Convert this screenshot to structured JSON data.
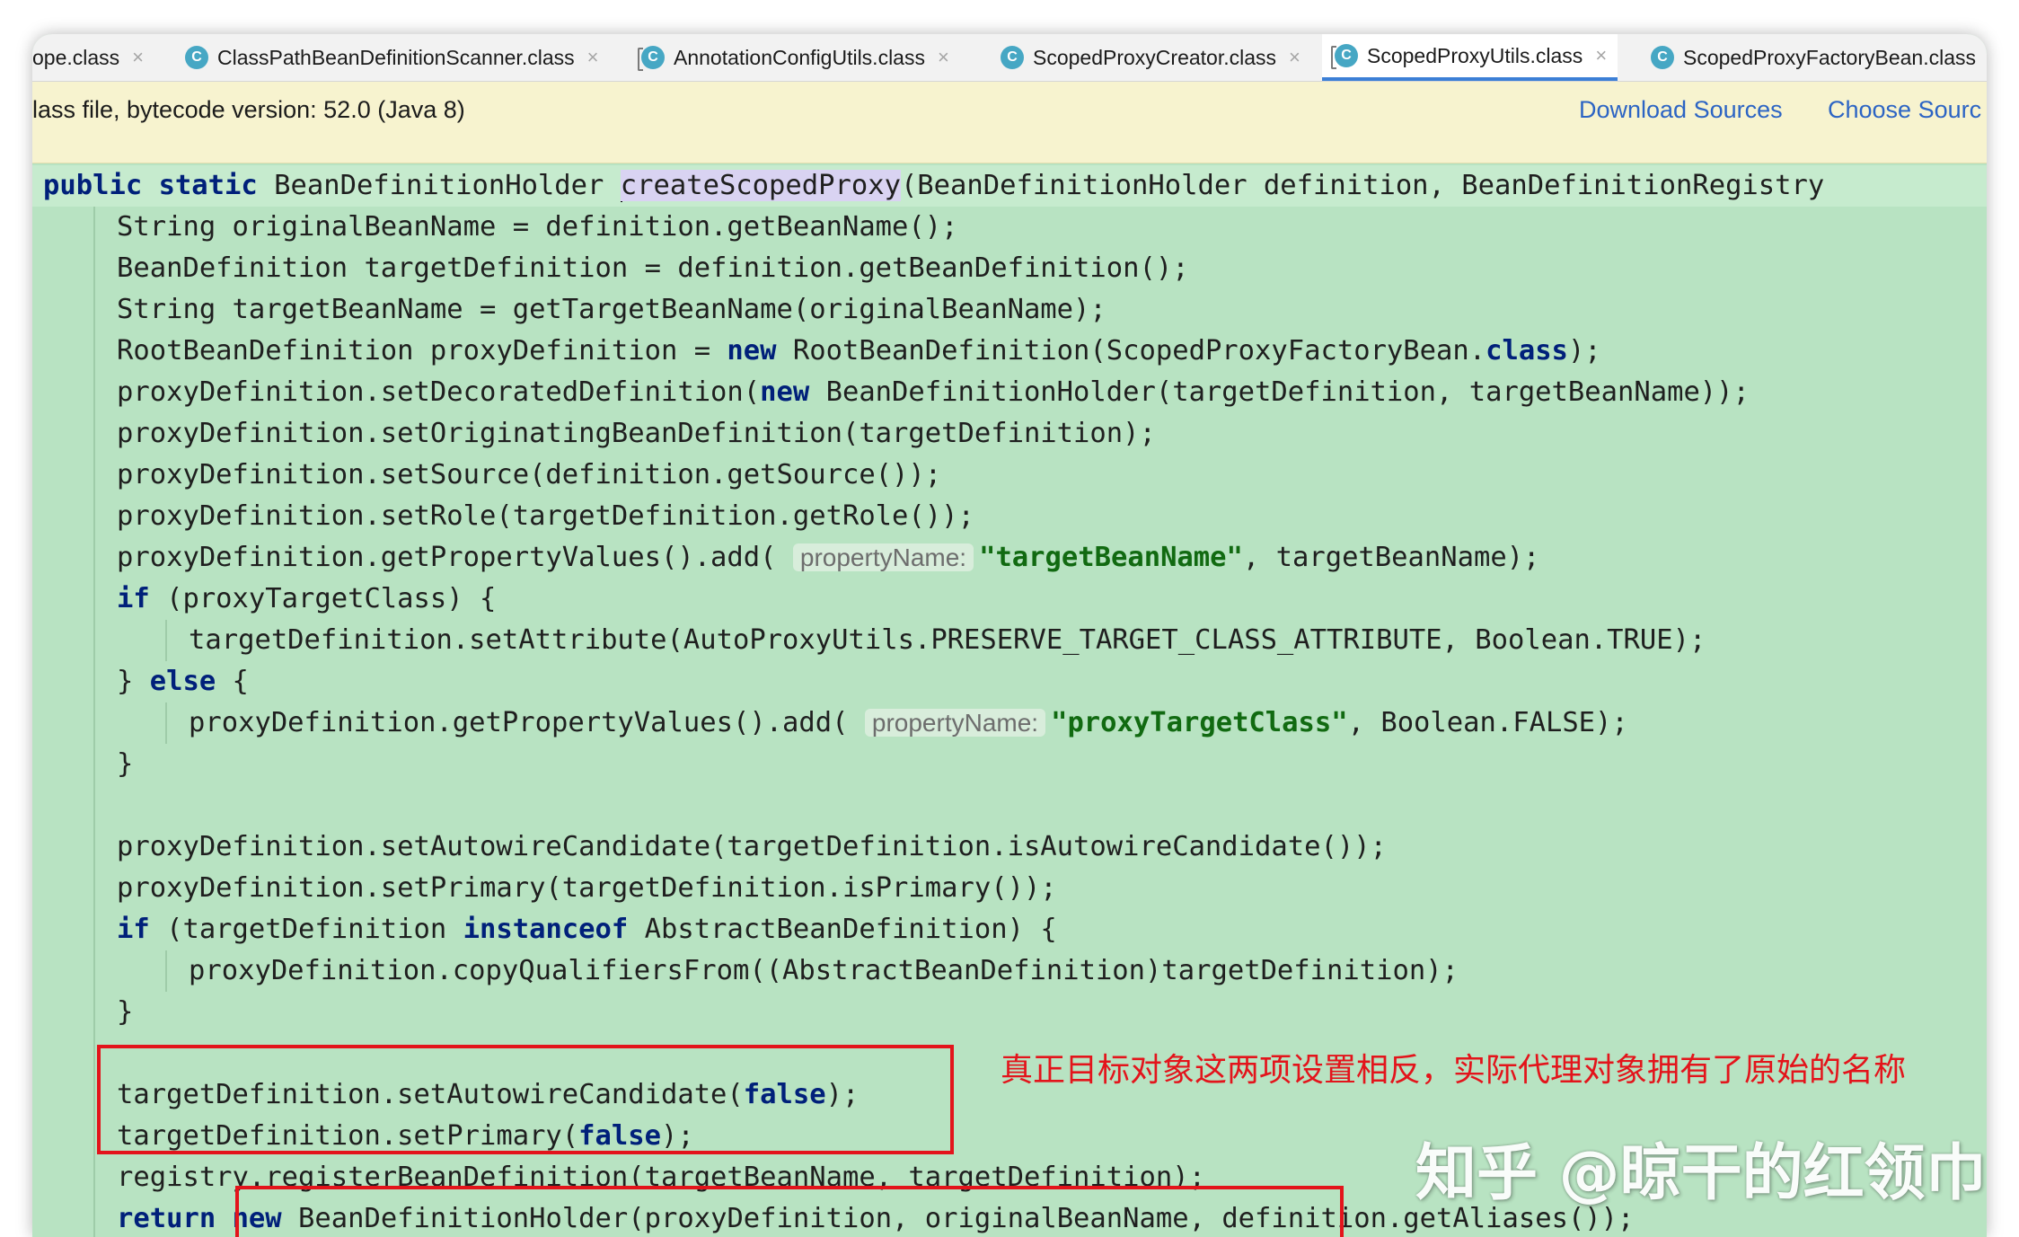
{
  "tabs": [
    {
      "label": "ope.class",
      "closable": true,
      "icon": "none",
      "active": false
    },
    {
      "label": "ClassPathBeanDefinitionScanner.class",
      "closable": true,
      "icon": "class-icon",
      "active": false
    },
    {
      "label": "AnnotationConfigUtils.class",
      "closable": true,
      "icon": "class-icon-locked",
      "active": false
    },
    {
      "label": "ScopedProxyCreator.class",
      "closable": true,
      "icon": "class-icon",
      "active": false
    },
    {
      "label": "ScopedProxyUtils.class",
      "closable": true,
      "icon": "class-icon-locked",
      "active": true
    },
    {
      "label": "ScopedProxyFactoryBean.class",
      "closable": false,
      "icon": "class-icon",
      "active": false
    }
  ],
  "tab_icon_letter": "C",
  "tab_close_glyph": "×",
  "notice": {
    "text": "lass file, bytecode version: 52.0 (Java 8)",
    "download_sources": "Download Sources",
    "choose_sources": "Choose Sourc"
  },
  "code": {
    "l1_kw1": "public",
    "l1_kw2": "static",
    "l1_type": "BeanDefinitionHolder",
    "l1_method": "createScopedProxy",
    "l1_params": "(BeanDefinitionHolder definition, BeanDefinitionRegistry",
    "l2": "String originalBeanName = definition.getBeanName();",
    "l3": "BeanDefinition targetDefinition = definition.getBeanDefinition();",
    "l4": "String targetBeanName = getTargetBeanName(originalBeanName);",
    "l5_a": "RootBeanDefinition proxyDefinition = ",
    "l5_new": "new",
    "l5_b": " RootBeanDefinition(ScopedProxyFactoryBean.",
    "l5_class": "class",
    "l5_c": ");",
    "l6_a": "proxyDefinition.setDecoratedDefinition(",
    "l6_new": "new",
    "l6_b": " BeanDefinitionHolder(targetDefinition, targetBeanName));",
    "l7": "proxyDefinition.setOriginatingBeanDefinition(targetDefinition);",
    "l8": "proxyDefinition.setSource(definition.getSource());",
    "l9": "proxyDefinition.setRole(targetDefinition.getRole());",
    "l10_a": "proxyDefinition.getPropertyValues().add(",
    "l10_hint": "propertyName:",
    "l10_str": "\"targetBeanName\"",
    "l10_b": ", targetBeanName);",
    "l11_if": "if",
    "l11_b": " (proxyTargetClass) {",
    "l12": "targetDefinition.setAttribute(AutoProxyUtils.PRESERVE_TARGET_CLASS_ATTRIBUTE, Boolean.TRUE);",
    "l13_a": "} ",
    "l13_else": "else",
    "l13_b": " {",
    "l14_a": "proxyDefinition.getPropertyValues().add(",
    "l14_hint": "propertyName:",
    "l14_str": "\"proxyTargetClass\"",
    "l14_b": ", Boolean.FALSE);",
    "l15": "}",
    "l17": "proxyDefinition.setAutowireCandidate(targetDefinition.isAutowireCandidate());",
    "l18": "proxyDefinition.setPrimary(targetDefinition.isPrimary());",
    "l19_if": "if",
    "l19_a": " (targetDefinition ",
    "l19_inst": "instanceof",
    "l19_b": " AbstractBeanDefinition) {",
    "l20": "proxyDefinition.copyQualifiersFrom((AbstractBeanDefinition)targetDefinition);",
    "l21": "}",
    "l23_a": "targetDefinition.setAutowireCandidate(",
    "l23_false": "false",
    "l23_b": ");",
    "l24_a": "targetDefinition.setPrimary(",
    "l24_false": "false",
    "l24_b": ");",
    "l25": "registry.registerBeanDefinition(targetBeanName, targetDefinition);",
    "l26_ret": "return",
    "l26_new": "new",
    "l26_a": " BeanDefinitionHolder(proxyDefinition, originalBeanName, definition.getAliases());"
  },
  "annotation": "真正目标对象这两项设置相反，实际代理对象拥有了原始的名称",
  "watermark": "知乎 @晾干的红领巾",
  "colors": {
    "editor_background": "#b8e3c2",
    "keyword": "#00207a",
    "string": "#116a11",
    "annotation_red": "#e3141b",
    "link": "#2c64c4",
    "notice_background": "#f7f3cf"
  }
}
